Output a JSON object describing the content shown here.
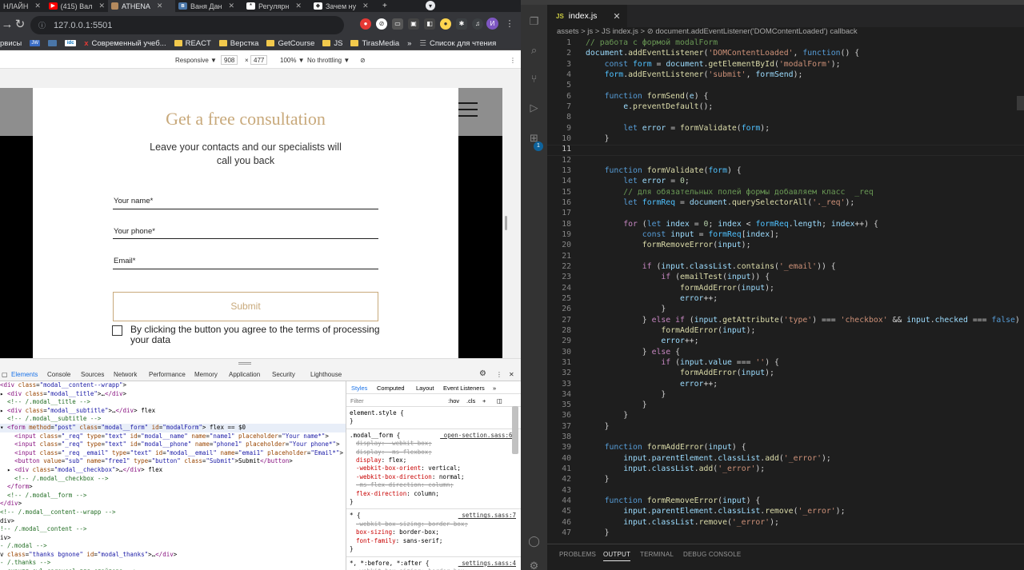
{
  "browser": {
    "tabs": [
      {
        "label": "НЛАЙН",
        "icon": "none"
      },
      {
        "label": "(415) Вал",
        "icon": "youtube-icon"
      },
      {
        "label": "ATHENA",
        "icon": "athena-icon"
      },
      {
        "label": "Ваня Дан",
        "icon": "vk-icon"
      },
      {
        "label": "Регулярн",
        "icon": "regex-icon"
      },
      {
        "label": "Зачем ну",
        "icon": "shield-icon"
      }
    ],
    "url": "127.0.0.1:5501",
    "bookmarks": [
      "рвисы",
      "JW",
      "",
      "idc",
      "Современный учеб...",
      "REACT",
      "Верстка",
      "GetCourse",
      "JS",
      "TirasMedia",
      "»",
      "Список для чтения"
    ],
    "profile_initial": "И",
    "devtools_toolbar": {
      "mode": "Responsive ▼",
      "width": "908",
      "times": "×",
      "height": "477",
      "zoom": "100% ▼",
      "throttle": "No throttling ▼"
    }
  },
  "modal": {
    "title": "Get a free consultation",
    "subtitle": "Leave your contacts and our specialists will call you back",
    "fields": [
      "Your name*",
      "Your phone*",
      "Email*"
    ],
    "submit": "Submit",
    "checkbox_text": "By clicking the button you agree to the terms of processing your data"
  },
  "devtools": {
    "tabs": [
      "Elements",
      "Console",
      "Sources",
      "Network",
      "Performance",
      "Memory",
      "Application",
      "Security",
      "Lighthouse"
    ],
    "style_tabs": [
      "Styles",
      "Computed",
      "Layout",
      "Event Listeners",
      "»"
    ],
    "filter_placeholder": "Filter",
    "filter_tools": [
      ":hov",
      ".cls",
      "+"
    ],
    "dom_lines": [
      "<div class=\"modal__content--wrapp\">",
      "▸ <div class=\"modal__title\">…</div>",
      "  <!-- /.modal__title -->",
      "▸ <div class=\"modal__subtitle\">…</div> flex",
      "  <!-- /.modal__subtitle -->",
      "▾ <form method=\"post\" class=\"modal__form\" id=\"modalForm\"> flex == $0",
      "    <input class=\"_req\" type=\"text\" id=\"modal__name\" name=\"name1\" placeholder=\"Your name*\">",
      "    <input class=\"_req\" type=\"text\" id=\"modal__phone\" name=\"phone1\" placeholder=\"Your phone*\">",
      "    <input class=\"_req _email\" type=\"text\" id=\"modal__email\" name=\"emai1\" placeholder=\"Email*\">",
      "    <button value=\"sub\" name=\"free1\" type=\"button\" class=\"Submit\">Submit</button>",
      "  ▸ <div class=\"modal__checkbox\">…</div> flex",
      "    <!-- /.modal__checkbox -->",
      "  </form>",
      "  <!-- /.modal__form -->",
      "</div>",
      "<!-- /.modal__content--wrapp -->",
      "div>",
      "!-- /.modal__content -->",
      "iv>",
      "- /.modal -->",
      "v class=\"thanks bgnone\" id=\"modal_thanks\">…</div>",
      "- /.thanks -->",
      "- скрипт owl carousel для слайдера -->"
    ],
    "styles": [
      {
        "selector": "element.style {",
        "source": "",
        "props": [
          "}"
        ]
      },
      {
        "selector": ".modal__form {",
        "source": "_open-section.sass:69",
        "props": [
          "display: -webkit-box;",
          "display: -ms-flexbox;",
          "display: flex;",
          "-webkit-box-orient: vertical;",
          "-webkit-box-direction: normal;",
          "-ms-flex-direction: column;",
          "flex-direction: column;",
          "}"
        ]
      },
      {
        "selector": "* {",
        "source": "_settings.sass:7",
        "props": [
          "-webkit-box-sizing: border-box;",
          "box-sizing: border-box;",
          "font-family: sans-serif;",
          "}"
        ]
      },
      {
        "selector": "*, *:before, *:after {",
        "source": "_settings.sass:4",
        "props": [
          "-webkit-box-sizing: border-box;",
          "box-sizing: border-box;"
        ]
      }
    ]
  },
  "editor": {
    "tab": "index.js",
    "breadcrumb": "assets > js > JS index.js > ⊘ document.addEventListener('DOMContentLoaded') callback",
    "current_line": 11,
    "lines": [
      "// работа с формой modalForm",
      "document.addEventListener('DOMContentLoaded', function() {",
      "    const form = document.getElementById('modalForm');",
      "    form.addEventListener('submit', formSend);",
      "",
      "    function formSend(e) {",
      "        e.preventDefault();",
      "",
      "        let error = formValidate(form);",
      "    }",
      "",
      "",
      "    function formValidate(form) {",
      "        let error = 0;",
      "        // для обязательных полей формы добавляем класс  _req",
      "        let formReq = document.querySelectorAll('._req');",
      "",
      "        for (let index = 0; index < formReq.length; index++) {",
      "            const input = formReq[index];",
      "            formRemoveError(input);",
      "",
      "            if (input.classList.contains('_email')) {",
      "                if (emailTest(input)) {",
      "                    formAddError(input);",
      "                    error++;",
      "                }",
      "            } else if (input.getAttribute('type') === 'checkbox' && input.checked === false) {",
      "                formAddError(input);",
      "                error++;",
      "            } else {",
      "                if (input.value === '') {",
      "                    formAddError(input);",
      "                    error++;",
      "                }",
      "            }",
      "        }",
      "    }",
      "",
      "    function formAddError(input) {",
      "        input.parentElement.classList.add('_error');",
      "        input.classList.add('_error');",
      "    }",
      "",
      "    function formRemoveError(input) {",
      "        input.parentElement.classList.remove('_error');",
      "        input.classList.remove('_error');",
      "    }"
    ],
    "panel_tabs": [
      "PROBLEMS",
      "OUTPUT",
      "TERMINAL",
      "DEBUG CONSOLE"
    ],
    "active_panel": "OUTPUT",
    "extensions_badge": "1"
  }
}
